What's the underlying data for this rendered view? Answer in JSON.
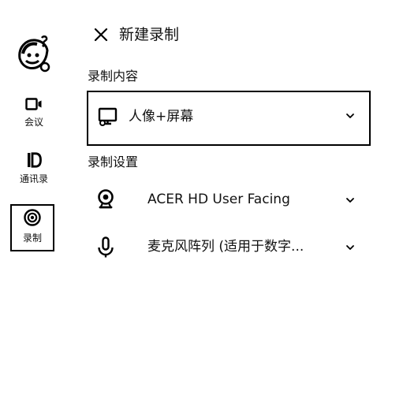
{
  "header": {
    "title": "新建录制",
    "close_icon": "close-icon"
  },
  "nav": {
    "items": [
      {
        "label": "会议",
        "icon": "camera-icon"
      },
      {
        "label": "通讯录",
        "icon": "id-card-icon"
      },
      {
        "label": "录制",
        "icon": "record-icon",
        "selected": true
      }
    ]
  },
  "content": {
    "section_label": "录制内容",
    "selected_value": "人像+屏幕",
    "icon": "monitor-icon"
  },
  "settings": {
    "section_label": "录制设置",
    "camera": {
      "value": "ACER HD User Facing",
      "icon": "webcam-icon"
    },
    "microphone": {
      "value": "麦克风阵列 (适用于数字...",
      "icon": "microphone-icon"
    }
  }
}
